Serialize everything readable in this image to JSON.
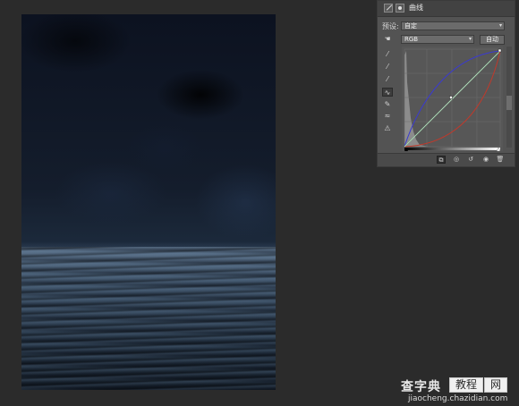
{
  "panel": {
    "title": "曲线",
    "preset_label": "预设:",
    "preset_value": "自定",
    "channel_value": "RGB",
    "auto_button": "自动"
  },
  "curve": {
    "colors": {
      "rgb": "#dcdcdc",
      "red": "#c0392b",
      "green": "#4fc06a",
      "blue": "#3a3ad0"
    }
  },
  "watermark": {
    "logo": "查字典",
    "box1": "教程",
    "box2": "网",
    "url": "jiaocheng.chazidian.com"
  }
}
